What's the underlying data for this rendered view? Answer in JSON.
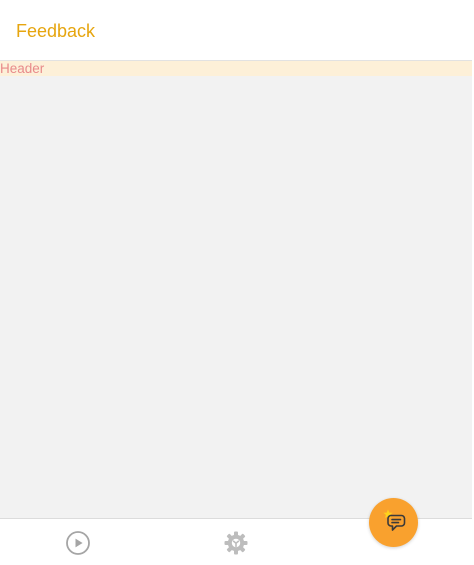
{
  "app": {
    "title": "Feedback",
    "title_color": "#e6a50f"
  },
  "content": {
    "header_label": "Header",
    "header_label_color": "#e88a8a",
    "header_bg": "#fdf0d8",
    "background": "#f2f2f2"
  },
  "tab_bar": {
    "tabs": [
      {
        "icon": "play-circle-icon"
      },
      {
        "icon": "gear-icon"
      }
    ]
  },
  "fab": {
    "icon": "feedback-chat-star-icon",
    "color": "#f9a12e"
  }
}
